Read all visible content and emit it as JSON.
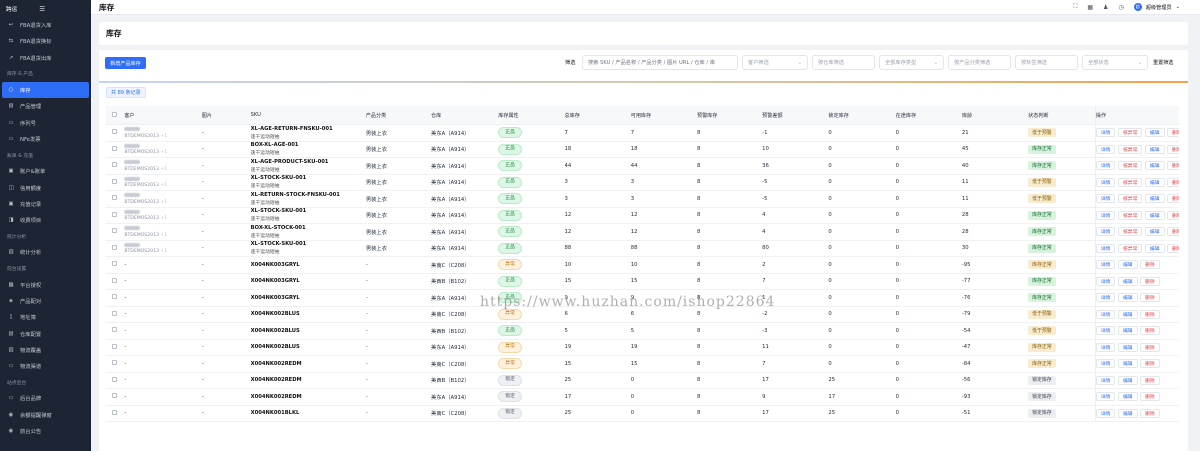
{
  "sidebar": {
    "app_title": "跨运",
    "items": [
      {
        "kind": "item",
        "label": "FBA退货入库",
        "icon": "↩"
      },
      {
        "kind": "item",
        "label": "FBA退货换标",
        "icon": "⇆"
      },
      {
        "kind": "item",
        "label": "FBA退货出库",
        "icon": "↗"
      },
      {
        "kind": "group",
        "label": "库存 & 产品"
      },
      {
        "kind": "item",
        "label": "库存",
        "icon": "○",
        "active": true
      },
      {
        "kind": "item",
        "label": "产品管理",
        "icon": "▤"
      },
      {
        "kind": "item",
        "label": "序列号",
        "icon": "▭"
      },
      {
        "kind": "item",
        "label": "NFe发票",
        "icon": "▭"
      },
      {
        "kind": "group",
        "label": "账单 & 充值"
      },
      {
        "kind": "item",
        "label": "账户&账单",
        "icon": "▣"
      },
      {
        "kind": "item",
        "label": "信用额度",
        "icon": "◫"
      },
      {
        "kind": "item",
        "label": "充值记录",
        "icon": "▣"
      },
      {
        "kind": "item",
        "label": "收费项目",
        "icon": "◨"
      },
      {
        "kind": "group",
        "label": "统计分析"
      },
      {
        "kind": "item",
        "label": "统计分析",
        "icon": "▥"
      },
      {
        "kind": "group",
        "label": "前台设置"
      },
      {
        "kind": "item",
        "label": "平台授权",
        "icon": "▦"
      },
      {
        "kind": "item",
        "label": "产品配对",
        "icon": "◈"
      },
      {
        "kind": "item",
        "label": "地址簿",
        "icon": "▯"
      },
      {
        "kind": "item",
        "label": "仓库配置",
        "icon": "▤"
      },
      {
        "kind": "item",
        "label": "物流覆盖",
        "icon": "▥"
      },
      {
        "kind": "item",
        "label": "物流渠道",
        "icon": "▭"
      },
      {
        "kind": "group",
        "label": "站点后台"
      },
      {
        "kind": "item",
        "label": "后台品牌",
        "icon": "▭"
      },
      {
        "kind": "item",
        "label": "余额提醒弹窗",
        "icon": "◉"
      },
      {
        "kind": "item",
        "label": "前台公告",
        "icon": "◉"
      }
    ]
  },
  "topbar": {
    "title": "库存",
    "user": "超级管理员",
    "avatar": "超"
  },
  "page": {
    "title": "库存"
  },
  "toolbar": {
    "new_button": "新增产品库存",
    "filter_label": "筛选",
    "search_placeholder": "搜索 SKU / 产品名称 / 产品分类 / 图片 URL / 仓库 / 库",
    "customer_filter": "客户筛选",
    "warehouse_filter": "按仓库筛选",
    "stock_type_filter": "全部库存类型",
    "category_filter": "按产品分类筛选",
    "tag_filter": "按标签筛选",
    "status_filter": "全部状态",
    "reset": "重置筛选"
  },
  "count_label": "共 89 条记录",
  "columns": [
    "",
    "客户",
    "图片",
    "SKU",
    "产品分类",
    "仓库",
    "库存属性",
    "总库存",
    "可用库存",
    "预警库存",
    "预警差额",
    "锁定库存",
    "在途库存",
    "库龄",
    "状态判断",
    "操作"
  ],
  "rows": [
    {
      "customer": true,
      "cust_code": "BTDEMOS2013",
      "cust_ext": "+1",
      "image": "-",
      "sku": "XL-AGE-RETURN-FNSKU-001",
      "sku_sub": "速干运动短袖",
      "category": "男装上衣",
      "warehouse": "美东A（A914）",
      "attr": "正品",
      "attr_t": "good",
      "total": "7",
      "avail": "7",
      "warn": "8",
      "diff": "-1",
      "locked": "0",
      "transit": "0",
      "age": "21",
      "status": "低于预警",
      "status_t": "low",
      "ops": "full"
    },
    {
      "customer": true,
      "cust_code": "BTDEMOS2013",
      "cust_ext": "+1",
      "image": "-",
      "sku": "BOX-XL-AGE-001",
      "sku_sub": "速干运动短袖",
      "category": "男装上衣",
      "warehouse": "美东A（A914）",
      "attr": "正品",
      "attr_t": "good",
      "total": "18",
      "avail": "18",
      "warn": "8",
      "diff": "10",
      "locked": "0",
      "transit": "0",
      "age": "45",
      "status": "库存正常",
      "status_t": "ok",
      "ops": "full"
    },
    {
      "customer": true,
      "cust_code": "BTDEMOS2013",
      "cust_ext": "+1",
      "image": "-",
      "sku": "XL-AGE-PRODUCT-SKU-001",
      "sku_sub": "速干运动短袖",
      "category": "男装上衣",
      "warehouse": "美东A（A914）",
      "attr": "正品",
      "attr_t": "good",
      "total": "44",
      "avail": "44",
      "warn": "8",
      "diff": "36",
      "locked": "0",
      "transit": "0",
      "age": "40",
      "status": "库存正常",
      "status_t": "ok",
      "ops": "full"
    },
    {
      "customer": true,
      "cust_code": "BTDEMOS2013",
      "cust_ext": "+1",
      "image": "-",
      "sku": "XL-STOCK-SKU-001",
      "sku_sub": "速干运动短袖",
      "category": "男装上衣",
      "warehouse": "美东A（A914）",
      "attr": "正品",
      "attr_t": "good",
      "total": "3",
      "avail": "3",
      "warn": "8",
      "diff": "-5",
      "locked": "0",
      "transit": "0",
      "age": "11",
      "status": "低于预警",
      "status_t": "low",
      "ops": "full"
    },
    {
      "customer": true,
      "cust_code": "BTDEMOS2013",
      "cust_ext": "+1",
      "image": "-",
      "sku": "XL-RETURN-STOCK-FNSKU-001",
      "sku_sub": "速干运动短袖",
      "category": "男装上衣",
      "warehouse": "美东A（A914）",
      "attr": "正品",
      "attr_t": "good",
      "total": "3",
      "avail": "3",
      "warn": "8",
      "diff": "-5",
      "locked": "0",
      "transit": "0",
      "age": "11",
      "status": "低于预警",
      "status_t": "low",
      "ops": "full"
    },
    {
      "customer": true,
      "cust_code": "BTDEMOS2013",
      "cust_ext": "+1",
      "image": "-",
      "sku": "XL-STOCK-SKU-001",
      "sku_sub": "速干运动短袖",
      "category": "男装上衣",
      "warehouse": "美东A（A914）",
      "attr": "正品",
      "attr_t": "good",
      "total": "12",
      "avail": "12",
      "warn": "8",
      "diff": "4",
      "locked": "0",
      "transit": "0",
      "age": "28",
      "status": "库存正常",
      "status_t": "ok",
      "ops": "full"
    },
    {
      "customer": true,
      "cust_code": "BTDEMOS2013",
      "cust_ext": "+1",
      "image": "-",
      "sku": "BOX-XL-STOCK-001",
      "sku_sub": "速干运动短袖",
      "category": "男装上衣",
      "warehouse": "美东A（A914）",
      "attr": "正品",
      "attr_t": "good",
      "total": "12",
      "avail": "12",
      "warn": "8",
      "diff": "4",
      "locked": "0",
      "transit": "0",
      "age": "28",
      "status": "库存正常",
      "status_t": "ok",
      "ops": "full"
    },
    {
      "customer": true,
      "cust_code": "BTDEMOS2013",
      "cust_ext": "+1",
      "image": "-",
      "sku": "XL-STOCK-SKU-001",
      "sku_sub": "速干运动短袖",
      "category": "男装上衣",
      "warehouse": "美东A（A914）",
      "attr": "正品",
      "attr_t": "good",
      "total": "88",
      "avail": "88",
      "warn": "8",
      "diff": "80",
      "locked": "0",
      "transit": "0",
      "age": "30",
      "status": "库存正常",
      "status_t": "ok",
      "ops": "full"
    },
    {
      "customer": false,
      "image": "-",
      "sku": "X004NK003GRYL",
      "sku_sub": "",
      "category": "-",
      "warehouse": "美南C（C208）",
      "attr": "异常",
      "attr_t": "bad",
      "total": "10",
      "avail": "10",
      "warn": "8",
      "diff": "2",
      "locked": "0",
      "transit": "0",
      "age": "-95",
      "status": "库存正常",
      "status_t": "stock",
      "ops": "short"
    },
    {
      "customer": false,
      "image": "-",
      "sku": "X004NK003GRYL",
      "sku_sub": "",
      "category": "-",
      "warehouse": "美西B（B102）",
      "attr": "正品",
      "attr_t": "good",
      "total": "15",
      "avail": "15",
      "warn": "8",
      "diff": "7",
      "locked": "0",
      "transit": "0",
      "age": "-77",
      "status": "库存正常",
      "status_t": "ok",
      "ops": "short"
    },
    {
      "customer": false,
      "image": "-",
      "sku": "X004NK003GRYL",
      "sku_sub": "",
      "category": "-",
      "warehouse": "美东A（A914）",
      "attr": "正品",
      "attr_t": "good",
      "total": "9",
      "avail": "9",
      "warn": "8",
      "diff": "1",
      "locked": "0",
      "transit": "0",
      "age": "-76",
      "status": "库存正常",
      "status_t": "ok",
      "ops": "short"
    },
    {
      "customer": false,
      "image": "-",
      "sku": "X004NK002BLUS",
      "sku_sub": "",
      "category": "-",
      "warehouse": "美南C（C208）",
      "attr": "异常",
      "attr_t": "bad",
      "total": "6",
      "avail": "6",
      "warn": "8",
      "diff": "-2",
      "locked": "0",
      "transit": "0",
      "age": "-79",
      "status": "低于预警",
      "status_t": "low",
      "ops": "short"
    },
    {
      "customer": false,
      "image": "-",
      "sku": "X004NK002BLUS",
      "sku_sub": "",
      "category": "-",
      "warehouse": "美西B（B102）",
      "attr": "正品",
      "attr_t": "good",
      "total": "5",
      "avail": "5",
      "warn": "8",
      "diff": "-3",
      "locked": "0",
      "transit": "0",
      "age": "-54",
      "status": "低于预警",
      "status_t": "low",
      "ops": "short"
    },
    {
      "customer": false,
      "image": "-",
      "sku": "X004NK002BLUS",
      "sku_sub": "",
      "category": "-",
      "warehouse": "美东A（A914）",
      "attr": "异常",
      "attr_t": "bad",
      "total": "19",
      "avail": "19",
      "warn": "8",
      "diff": "11",
      "locked": "0",
      "transit": "0",
      "age": "-47",
      "status": "库存正常",
      "status_t": "stock",
      "ops": "short"
    },
    {
      "customer": false,
      "image": "-",
      "sku": "X004NK002REDM",
      "sku_sub": "",
      "category": "-",
      "warehouse": "美南C（C208）",
      "attr": "异常",
      "attr_t": "bad",
      "total": "15",
      "avail": "15",
      "warn": "8",
      "diff": "7",
      "locked": "0",
      "transit": "0",
      "age": "-84",
      "status": "库存正常",
      "status_t": "stock",
      "ops": "short"
    },
    {
      "customer": false,
      "image": "-",
      "sku": "X004NK002REDM",
      "sku_sub": "",
      "category": "-",
      "warehouse": "美西B（B102）",
      "attr": "锁定",
      "attr_t": "lock",
      "total": "25",
      "avail": "0",
      "warn": "8",
      "diff": "17",
      "locked": "25",
      "transit": "0",
      "age": "-56",
      "status": "锁定库存",
      "status_t": "lock",
      "ops": "short"
    },
    {
      "customer": false,
      "image": "-",
      "sku": "X004NK002REDM",
      "sku_sub": "",
      "category": "-",
      "warehouse": "美东A（A914）",
      "attr": "锁定",
      "attr_t": "lock",
      "total": "17",
      "avail": "0",
      "warn": "8",
      "diff": "9",
      "locked": "17",
      "transit": "0",
      "age": "-93",
      "status": "锁定库存",
      "status_t": "lock",
      "ops": "short"
    },
    {
      "customer": false,
      "image": "-",
      "sku": "X004NK001BLKL",
      "sku_sub": "",
      "category": "-",
      "warehouse": "美南C（C208）",
      "attr": "锁定",
      "attr_t": "lock",
      "total": "25",
      "avail": "0",
      "warn": "8",
      "diff": "17",
      "locked": "25",
      "transit": "0",
      "age": "-51",
      "status": "锁定库存",
      "status_t": "lock",
      "ops": "short"
    }
  ],
  "actions": {
    "detail": "详情",
    "check": "核异常",
    "edit": "编辑",
    "delete": "删除"
  },
  "watermark": "https://www.huzhan.com/ishop22864"
}
